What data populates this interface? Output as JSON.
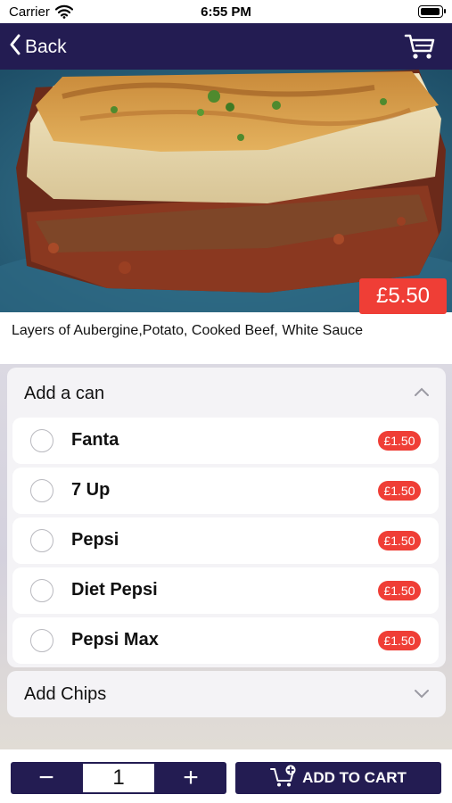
{
  "status_bar": {
    "carrier": "Carrier",
    "time": "6:55 PM",
    "battery_level": 0.9
  },
  "nav": {
    "back_label": "Back",
    "cart_icon": "cart-icon"
  },
  "product": {
    "price": "£5.50",
    "description": "Layers of Aubergine,Potato, Cooked Beef, White Sauce"
  },
  "groups": [
    {
      "title": "Add a can",
      "expanded": true,
      "items": [
        {
          "label": "Fanta",
          "price": "£1.50"
        },
        {
          "label": "7 Up",
          "price": "£1.50"
        },
        {
          "label": "Pepsi",
          "price": "£1.50"
        },
        {
          "label": "Diet Pepsi",
          "price": "£1.50"
        },
        {
          "label": "Pepsi Max",
          "price": "£1.50"
        }
      ]
    },
    {
      "title": "Add Chips",
      "expanded": false
    }
  ],
  "footer": {
    "minus": "−",
    "quantity": "1",
    "plus": "+",
    "add_to_cart": "ADD TO CART"
  },
  "colors": {
    "navy": "#231c52",
    "accent_red": "#ef3e36"
  }
}
